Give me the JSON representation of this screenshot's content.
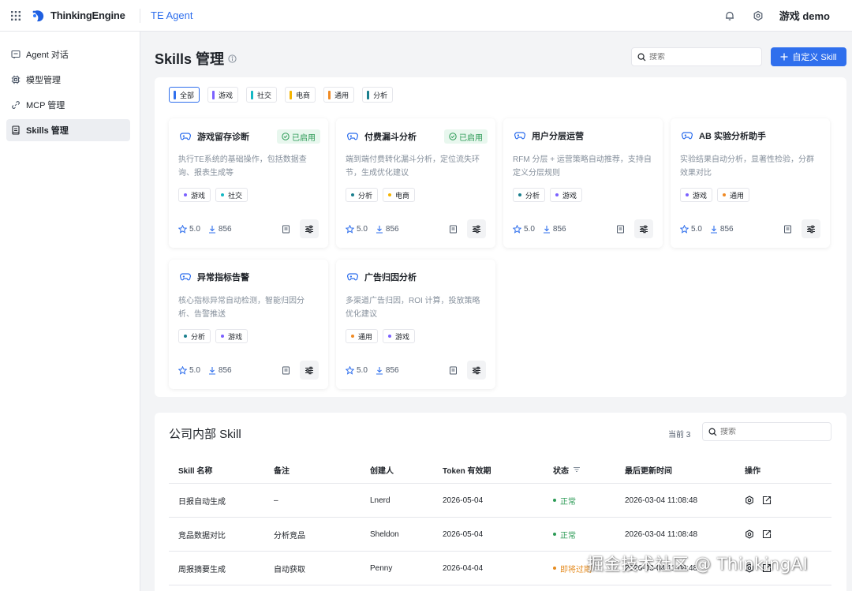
{
  "header": {
    "brand": "ThinkingEngine",
    "product": "TE Agent",
    "user": "游戏 demo"
  },
  "sidebar": {
    "items": [
      {
        "label": "Agent 对话",
        "icon": "chat-icon"
      },
      {
        "label": "模型管理",
        "icon": "chip-icon"
      },
      {
        "label": "MCP 管理",
        "icon": "link-icon"
      },
      {
        "label": "Skills 管理",
        "icon": "book-icon",
        "active": true
      }
    ]
  },
  "page": {
    "title": "Skills 管理",
    "search_placeholder": "搜索",
    "add_label": "自定义 Skill"
  },
  "filters": [
    {
      "label": "全部",
      "color": "",
      "active": true
    },
    {
      "label": "游戏",
      "color": "#7b61ff"
    },
    {
      "label": "社交",
      "color": "#14b8c4"
    },
    {
      "label": "电商",
      "color": "#f5b400"
    },
    {
      "label": "通用",
      "color": "#f08a24"
    },
    {
      "label": "分析",
      "color": "#1a7f8e"
    }
  ],
  "tag_colors": {
    "游戏": "#7b61ff",
    "社交": "#14b8c4",
    "电商": "#f5b400",
    "通用": "#f08a24",
    "分析": "#1a7f8e"
  },
  "cards": [
    {
      "title": "游戏留存诊断",
      "enabled": true,
      "desc": "执行TE系统的基础操作，包括数据查询、报表生成等",
      "tags": [
        "游戏",
        "社交"
      ],
      "rating": "5.0",
      "downloads": "856"
    },
    {
      "title": "付费漏斗分析",
      "enabled": true,
      "desc": "端到端付费转化漏斗分析，定位流失环节，生成优化建议",
      "tags": [
        "分析",
        "电商"
      ],
      "rating": "5.0",
      "downloads": "856"
    },
    {
      "title": "用户分层运营",
      "enabled": false,
      "desc": "RFM 分层 + 运营策略自动推荐，支持自定义分层规则",
      "tags": [
        "分析",
        "游戏"
      ],
      "rating": "5.0",
      "downloads": "856"
    },
    {
      "title": "AB 实验分析助手",
      "enabled": false,
      "desc": "实验结果自动分析，显著性检验，分群效果对比",
      "tags": [
        "游戏",
        "通用"
      ],
      "rating": "5.0",
      "downloads": "856"
    },
    {
      "title": "异常指标告警",
      "enabled": false,
      "desc": "核心指标异常自动检测，智能归因分析、告警推送",
      "tags": [
        "分析",
        "游戏"
      ],
      "rating": "5.0",
      "downloads": "856"
    },
    {
      "title": "广告归因分析",
      "enabled": false,
      "desc": "多渠道广告归因，ROI 计算，投放策略优化建议",
      "tags": [
        "通用",
        "游戏"
      ],
      "rating": "5.0",
      "downloads": "856"
    }
  ],
  "enabled_label": "已启用",
  "internal": {
    "title": "公司内部 Skill",
    "count": "当前 3",
    "search_placeholder": "搜索",
    "columns": [
      "Skill 名称",
      "备注",
      "创建人",
      "Token 有效期",
      "状态",
      "最后更新时间",
      "操作"
    ],
    "rows": [
      {
        "name": "日报自动生成",
        "note": "–",
        "creator": "Lnerd",
        "expiry": "2026-05-04",
        "status": "正常",
        "status_type": "ok",
        "updated": "2026-03-04 11:08:48"
      },
      {
        "name": "竞品数据对比",
        "note": "分析竞品",
        "creator": "Sheldon",
        "expiry": "2026-05-04",
        "status": "正常",
        "status_type": "ok",
        "updated": "2026-03-04 11:08:48"
      },
      {
        "name": "周报摘要生成",
        "note": "自动获取",
        "creator": "Penny",
        "expiry": "2026-04-04",
        "status": "即将过期",
        "status_type": "warn",
        "updated": "2026-03-04 11:08:48"
      }
    ]
  },
  "watermark": "掘金技术社区 @ ThinkingAI"
}
